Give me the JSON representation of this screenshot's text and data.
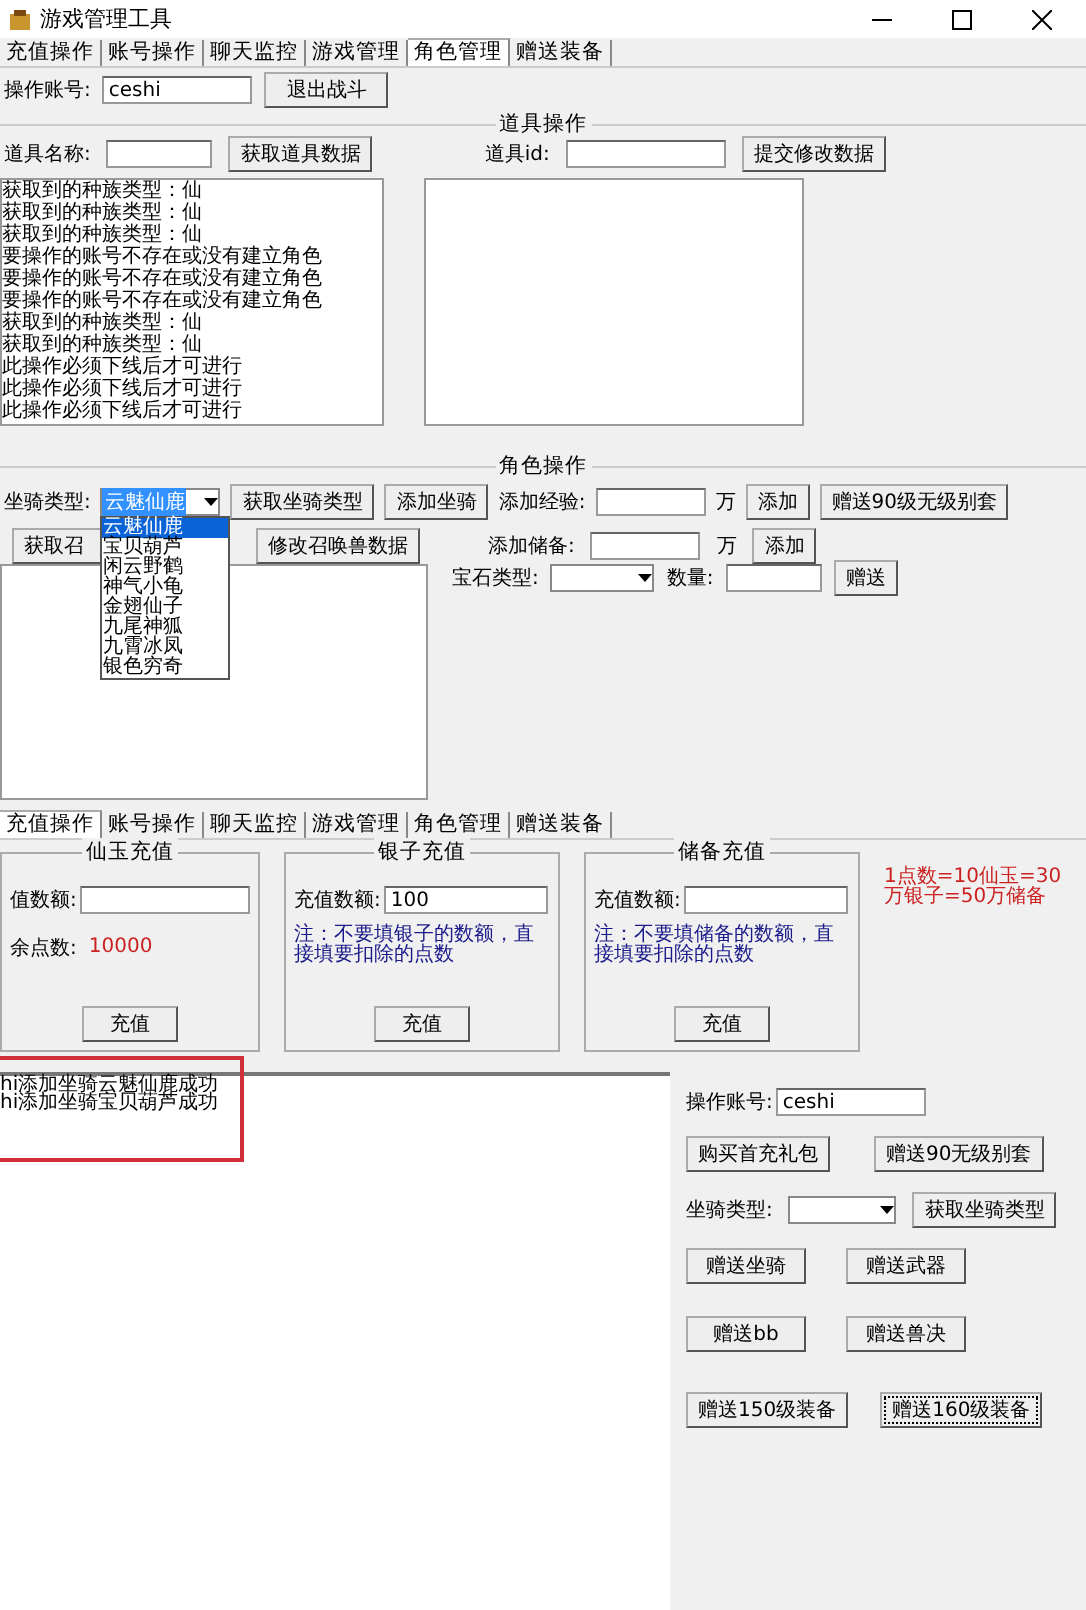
{
  "top_window": {
    "title": "游戏管理工具",
    "tabs": [
      {
        "label": "充值操作",
        "selected": false
      },
      {
        "label": "账号操作",
        "selected": false
      },
      {
        "label": "聊天监控",
        "selected": false
      },
      {
        "label": "游戏管理",
        "selected": false
      },
      {
        "label": "角色管理",
        "selected": true
      },
      {
        "label": "赠送装备",
        "selected": false
      }
    ],
    "account": {
      "label": "操作账号:",
      "value": "ceshi",
      "button": "退出战斗"
    },
    "item_group": {
      "title": "道具操作",
      "name_label": "道具名称:",
      "fetch_button": "获取道具数据",
      "id_label": "道具id:",
      "submit_button": "提交修改数据",
      "log": [
        "获取到的种族类型：仙",
        "获取到的种族类型：仙",
        "获取到的种族类型：仙",
        "要操作的账号不存在或没有建立角色",
        "要操作的账号不存在或没有建立角色",
        "要操作的账号不存在或没有建立角色",
        "获取到的种族类型：仙",
        "获取到的种族类型：仙",
        "此操作必须下线后才可进行",
        "此操作必须下线后才可进行",
        "此操作必须下线后才可进行"
      ]
    },
    "role_group": {
      "title": "角色操作",
      "mount_label": "坐骑类型:",
      "mount_value": "云魅仙鹿",
      "mount_options": [
        {
          "label": "云魅仙鹿",
          "selected": true
        },
        {
          "label": "宝贝葫芦",
          "selected": false
        },
        {
          "label": "闲云野鹤",
          "selected": false
        },
        {
          "label": "神气小龟",
          "selected": false
        },
        {
          "label": "金翅仙子",
          "selected": false
        },
        {
          "label": "九尾神狐",
          "selected": false
        },
        {
          "label": "九霄冰凤",
          "selected": false
        },
        {
          "label": "银色穷奇",
          "selected": false
        }
      ],
      "get_mount_button": "获取坐骑类型",
      "add_mount_button": "添加坐骑",
      "exp_label": "添加经验:",
      "exp_unit": "万",
      "exp_button": "添加",
      "gift_button": "赠送90级无级别套",
      "reserve_label": "添加储备:",
      "reserve_unit": "万",
      "reserve_button": "添加",
      "get_pet_button": "获取召",
      "edit_pet_button": "修改召唤兽数据",
      "gem_label": "宝石类型:",
      "qty_label": "数量:",
      "gem_button": "赠送"
    }
  },
  "bottom_window": {
    "tabs": [
      {
        "label": "充值操作",
        "selected": true
      },
      {
        "label": "账号操作",
        "selected": false
      },
      {
        "label": "聊天监控",
        "selected": false
      },
      {
        "label": "游戏管理",
        "selected": false
      },
      {
        "label": "角色管理",
        "selected": false
      },
      {
        "label": "赠送装备",
        "selected": false
      }
    ],
    "groups": [
      {
        "title": "仙玉充值",
        "amount_label": "值数额:",
        "points_label": "余点数:",
        "points_value": "10000",
        "button": "充值"
      },
      {
        "title": "银子充值",
        "amount_label": "充值数额:",
        "amount_value": "100",
        "note": "注：不要填银子的数额，直接填要扣除的点数",
        "button": "充值"
      },
      {
        "title": "储备充值",
        "amount_label": "充值数额:",
        "note": "注：不要填储备的数额，直接填要扣除的点数",
        "button": "充值"
      }
    ],
    "rate_note": "1点数=10仙玉=30万银子=50万储备",
    "log": [
      "hi添加坐骑云魅仙鹿成功",
      "hi添加坐骑宝贝葫芦成功"
    ],
    "panel": {
      "account_label": "操作账号:",
      "account_value": "ceshi",
      "buttons_row1": [
        "购买首充礼包",
        "赠送90无级别套"
      ],
      "mount_label": "坐骑类型:",
      "mount_button": "获取坐骑类型",
      "buttons_row2": [
        "赠送坐骑",
        "赠送武器"
      ],
      "buttons_row3": [
        "赠送bb",
        "赠送兽决"
      ],
      "buttons_row4": [
        "赠送150级装备",
        "赠送160级装备"
      ]
    }
  }
}
